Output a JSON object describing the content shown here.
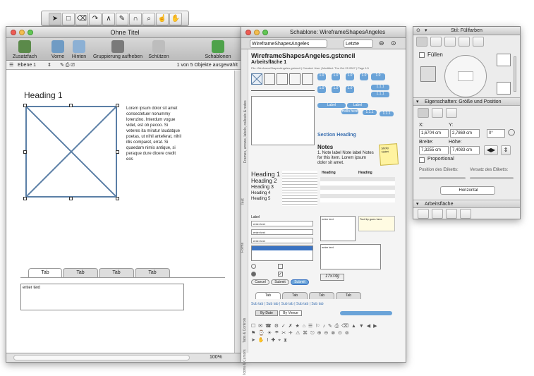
{
  "palette": {
    "tools": [
      "arrow-icon",
      "rectangle-icon",
      "eraser-icon",
      "curve-icon",
      "line-icon",
      "pen-icon",
      "magnet-icon",
      "zoom-icon",
      "hand-icon",
      "grab-icon"
    ]
  },
  "doc": {
    "title": "Ohne Titel",
    "toolbar": {
      "storage": "Zusatzfach",
      "front": "Vorne",
      "back": "Hinten",
      "ungroup": "Gruppierung aufheben",
      "protect": "Schützen",
      "stencils": "Schablonen"
    },
    "layer": "Ebene 1",
    "selection_status": "1 von 5 Objekte ausgewählt",
    "heading": "Heading 1",
    "lorem": "Lorem ipsum dolor sit amet consectetuer nonummy lorenzino. Interdum vogue videt, est ob pecoo. Si veteres ita miratur laudatque poetas, ut nihil anteferat, nihil illis comparet, errat. Si quaedam nimis antique, si peraque dure dicere credit eos",
    "tabs": [
      "Tab",
      "Tab",
      "Tab",
      "Tab"
    ],
    "text_area": "enter text",
    "zoom": "100%"
  },
  "stencil": {
    "title": "Schablone: WireframeShapesAngeles",
    "select_value": "WireframeShapesAngeles",
    "recent_label": "Letzte",
    "heading": "WireframeShapesAngeles.gstencil",
    "sub": "Arbeitsfläche 1",
    "meta": "File: WireframeShapesAngeles.gstencil  |  Created: Uwe  |  Modified: Thu Oct 25 2007  |  Page 1/1",
    "section_heading": "Section Heading",
    "notes_title": "Notes",
    "notes_text": "1. Note label Note label Notes for this item. Lorem ipsum dolor sit amet.",
    "headings": [
      "Heading 1",
      "Heading 2",
      "Heading 3",
      "Heading 4",
      "Heading 5"
    ],
    "table_header": [
      "Heading",
      "Heading"
    ],
    "table_cell": "Table cell",
    "labels": [
      "Label",
      "Label",
      "Label"
    ],
    "enter_text": "enter text",
    "buttons": [
      "Cancel",
      "Submit",
      "Submit"
    ],
    "tabs": [
      "Tab",
      "Tab",
      "Tab",
      "Tab"
    ],
    "subtabs": [
      "Sub tab",
      "Sub tab",
      "Sub tab",
      "Sub tab",
      "Sub tab",
      "Sub tab"
    ],
    "date_btn": "By Date",
    "venue_btn": "By Venue",
    "captcha": "17x74g",
    "side_labels": [
      "Frames, arrows, labels, callouts & notes",
      "Text",
      "Forms",
      "Tabs & Controls",
      "Icons & Cursors"
    ]
  },
  "inspector": {
    "title": "Stil: Füllfarben",
    "fill_label": "Füllen",
    "geometry_title": "Eigenschaften: Größe und Position",
    "x_label": "X:",
    "x_value": "1,6704 cm",
    "y_label": "Y:",
    "y_value": "2,7869 cm",
    "angle": "0°",
    "width_label": "Breite:",
    "width_value": "7,3255 cm",
    "height_label": "Höhe:",
    "height_value": "7,4083 cm",
    "proportional": "Proportional",
    "label_pos": "Position des Etiketts:",
    "label_offset": "Versatz des Etiketts:",
    "orientation": "Horizontal",
    "canvas_title": "Arbeitsfläche"
  }
}
